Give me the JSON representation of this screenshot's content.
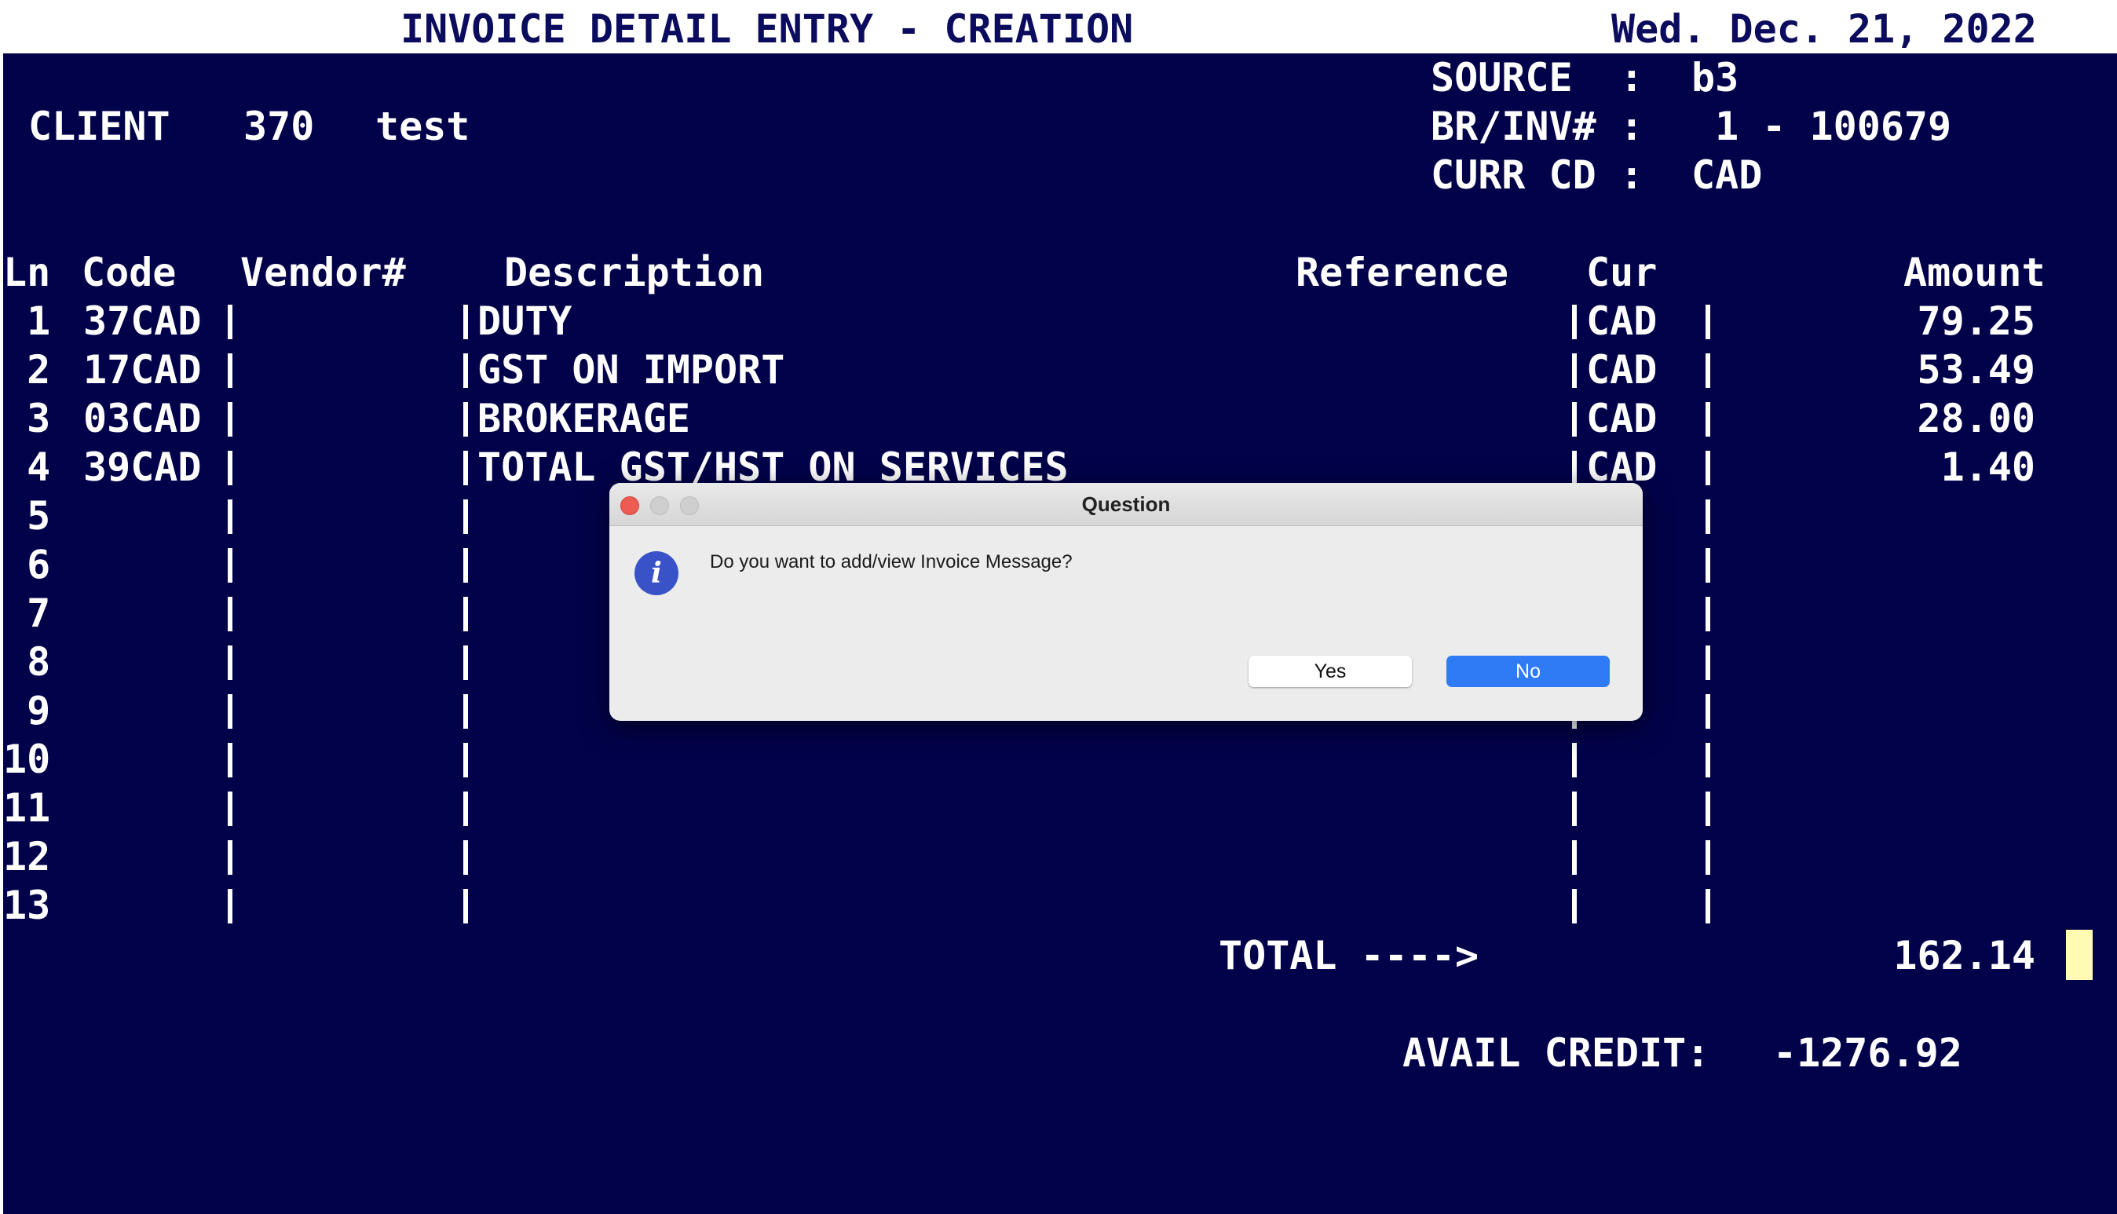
{
  "header": {
    "title": "INVOICE DETAIL ENTRY - CREATION",
    "date": "Wed. Dec. 21, 2022"
  },
  "client": {
    "label": "CLIENT",
    "number": "370",
    "name": "test"
  },
  "info": {
    "source_label": "SOURCE  :",
    "source_value": "b3",
    "brinv_label": "BR/INV# :",
    "brinv_value": " 1 - 100679",
    "curr_label": "CURR CD :",
    "curr_value": "CAD"
  },
  "columns": {
    "ln": "Ln",
    "code": "Code",
    "vendor": "Vendor#",
    "description": "Description",
    "reference": "Reference",
    "cur": "Cur",
    "amount": "Amount"
  },
  "rows": [
    {
      "ln": " 1",
      "code": "37CAD",
      "description": "DUTY",
      "cur": "CAD",
      "amount": "79.25"
    },
    {
      "ln": " 2",
      "code": "17CAD",
      "description": "GST ON IMPORT",
      "cur": "CAD",
      "amount": "53.49"
    },
    {
      "ln": " 3",
      "code": "03CAD",
      "description": "BROKERAGE",
      "cur": "CAD",
      "amount": "28.00"
    },
    {
      "ln": " 4",
      "code": "39CAD",
      "description": "TOTAL GST/HST ON SERVICES",
      "cur": "CAD",
      "amount": "1.40"
    },
    {
      "ln": " 5",
      "code": "",
      "description": "",
      "cur": "",
      "amount": ""
    },
    {
      "ln": " 6",
      "code": "",
      "description": "",
      "cur": "",
      "amount": ""
    },
    {
      "ln": " 7",
      "code": "",
      "description": "",
      "cur": "",
      "amount": ""
    },
    {
      "ln": " 8",
      "code": "",
      "description": "",
      "cur": "",
      "amount": ""
    },
    {
      "ln": " 9",
      "code": "",
      "description": "",
      "cur": "",
      "amount": ""
    },
    {
      "ln": "10",
      "code": "",
      "description": "",
      "cur": "",
      "amount": ""
    },
    {
      "ln": "11",
      "code": "",
      "description": "",
      "cur": "",
      "amount": ""
    },
    {
      "ln": "12",
      "code": "",
      "description": "",
      "cur": "",
      "amount": ""
    },
    {
      "ln": "13",
      "code": "",
      "description": "",
      "cur": "",
      "amount": ""
    }
  ],
  "footer": {
    "total_label": "TOTAL ---->",
    "total_value": "162.14",
    "credit_label": "AVAIL CREDIT:",
    "credit_value": "-1276.92"
  },
  "dialog": {
    "title": "Question",
    "icon": "info-icon",
    "message": "Do you want to add/view Invoice Message?",
    "yes_label": "Yes",
    "no_label": "No"
  },
  "colors": {
    "terminal_background": "#02024a",
    "terminal_text": "#ffffff",
    "cursor": "#fffbb2",
    "default_button": "#2f7bf6"
  }
}
